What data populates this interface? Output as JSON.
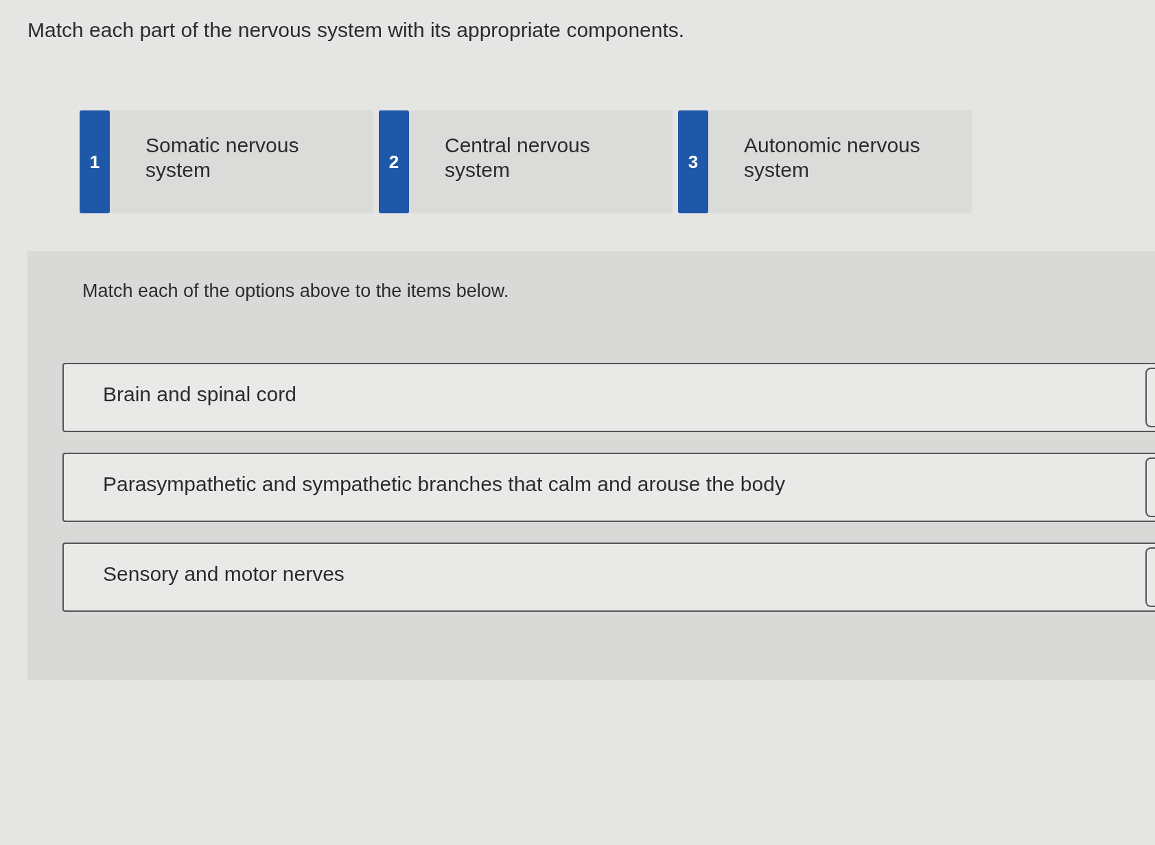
{
  "question": {
    "prompt": "Match each part of the nervous system with its appropriate components."
  },
  "options": [
    {
      "number": "1",
      "label": "Somatic nervous system"
    },
    {
      "number": "2",
      "label": "Central nervous system"
    },
    {
      "number": "3",
      "label": "Autonomic nervous system"
    }
  ],
  "match_panel": {
    "instruction": "Match each of the options above to the items below.",
    "items": [
      {
        "text": "Brain and spinal cord"
      },
      {
        "text": "Parasympathetic and sympathetic branches that calm and arouse the body"
      },
      {
        "text": "Sensory and motor nerves"
      }
    ]
  }
}
